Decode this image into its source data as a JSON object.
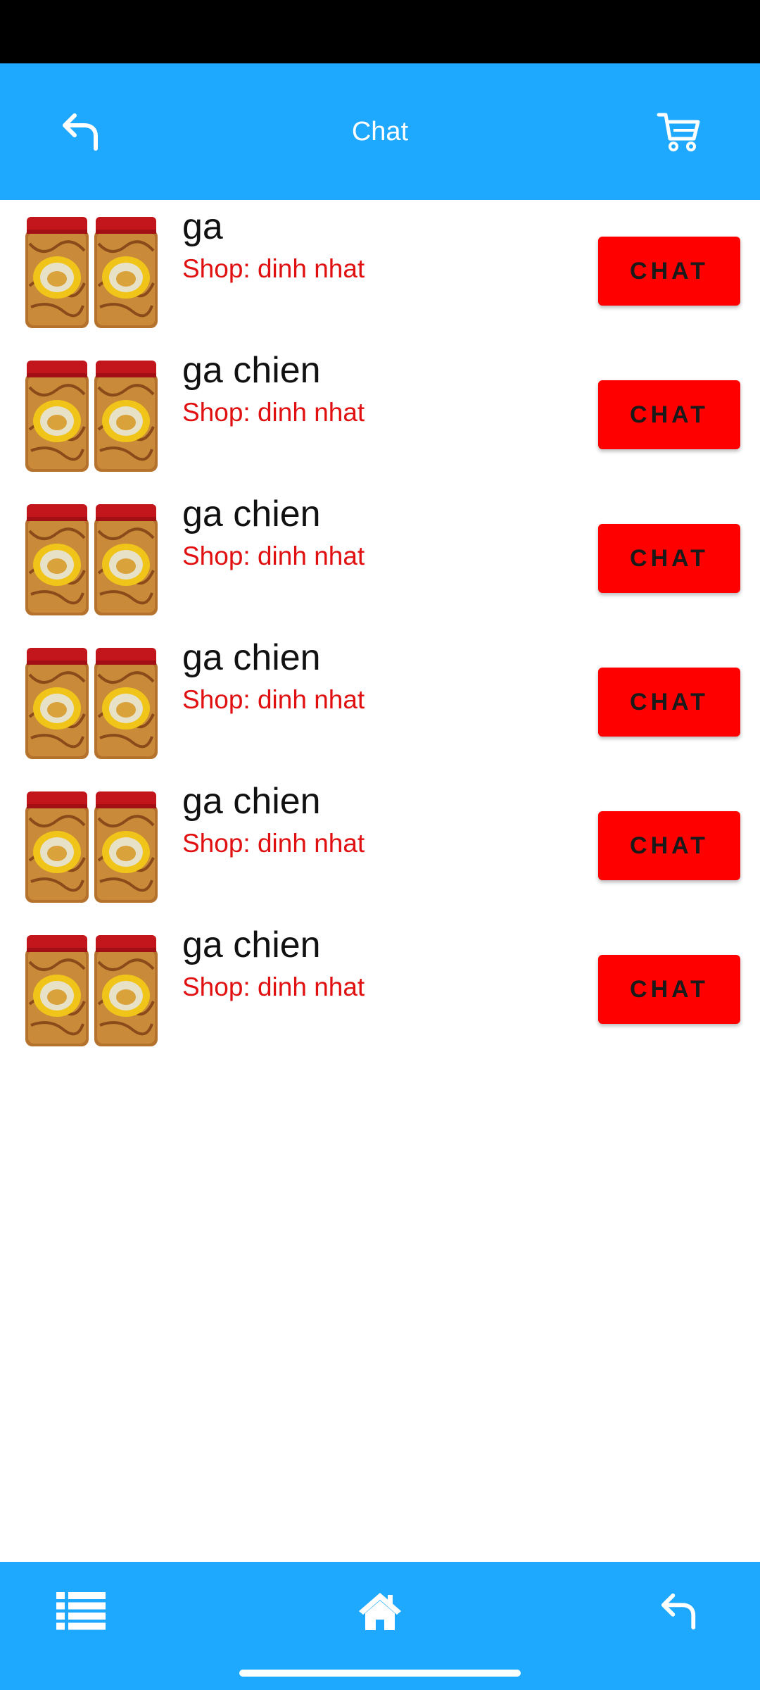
{
  "header": {
    "title": "Chat",
    "back_icon": "back-arrow-icon",
    "cart_icon": "shopping-cart-icon"
  },
  "colors": {
    "primary": "#1ea9ff",
    "button": "#ff0000",
    "shop_text": "#e01010"
  },
  "items": [
    {
      "name": "ga",
      "shop": "Shop: dinh nhat",
      "button": "CHAT"
    },
    {
      "name": "ga chien",
      "shop": "Shop: dinh nhat",
      "button": "CHAT"
    },
    {
      "name": "ga chien",
      "shop": "Shop: dinh nhat",
      "button": "CHAT"
    },
    {
      "name": "ga chien",
      "shop": "Shop: dinh nhat",
      "button": "CHAT"
    },
    {
      "name": "ga chien",
      "shop": "Shop: dinh nhat",
      "button": "CHAT"
    },
    {
      "name": "ga chien",
      "shop": "Shop: dinh nhat",
      "button": "CHAT"
    }
  ],
  "bottom_nav": {
    "list_icon": "list-icon",
    "home_icon": "home-icon",
    "back_icon": "back-arrow-icon"
  }
}
